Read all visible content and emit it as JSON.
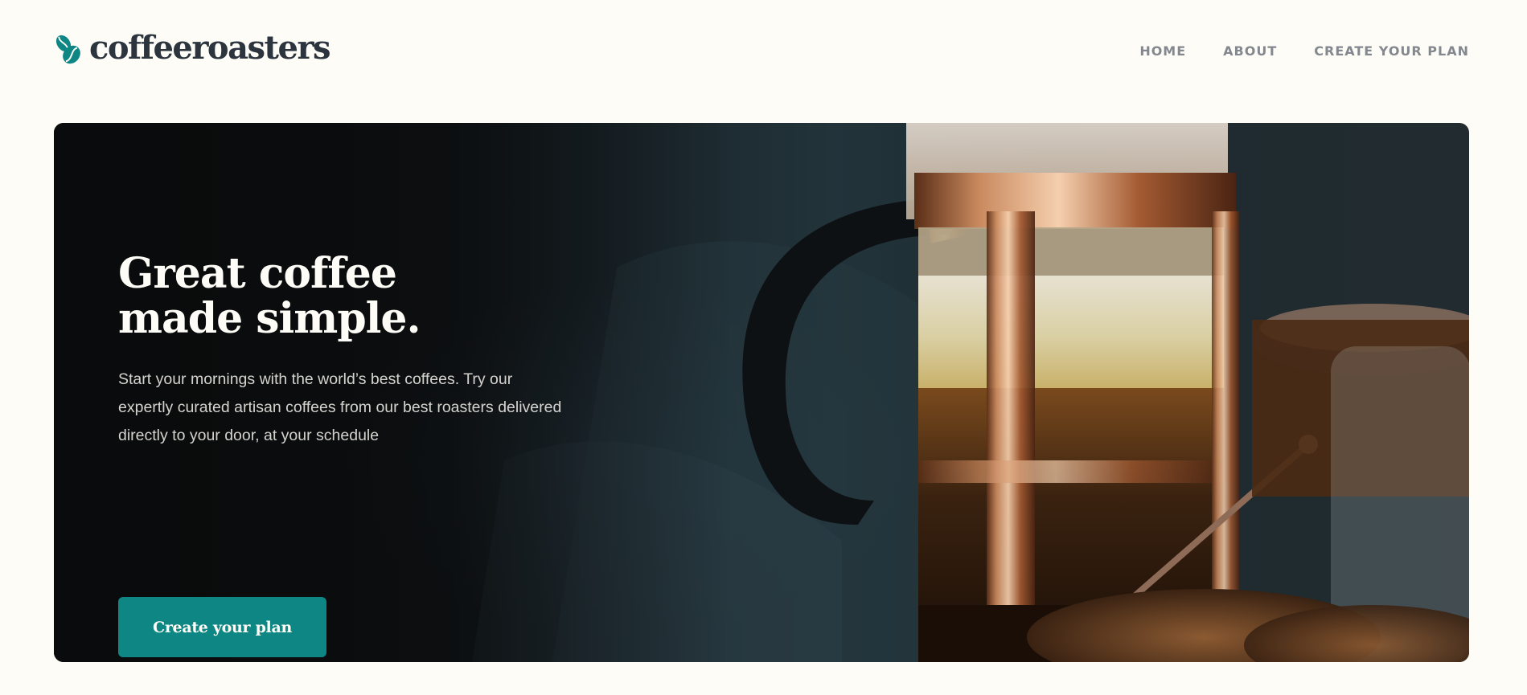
{
  "brand": {
    "name": "coffeeroasters",
    "logo_icon": "coffee-bean-logo-icon",
    "accent_color": "#0E8784",
    "text_color": "#2C343E"
  },
  "nav": {
    "items": [
      {
        "label": "HOME"
      },
      {
        "label": "ABOUT"
      },
      {
        "label": "CREATE YOUR PLAN"
      }
    ]
  },
  "hero": {
    "title": "Great coffee\nmade simple.",
    "description": "Start your mornings with the world’s best coffees. Try our expertly curated artisan coffees from our best roasters delivered directly to your door, at your schedule",
    "cta_label": "Create your plan",
    "image_subject": "french-press-coffee-image"
  }
}
